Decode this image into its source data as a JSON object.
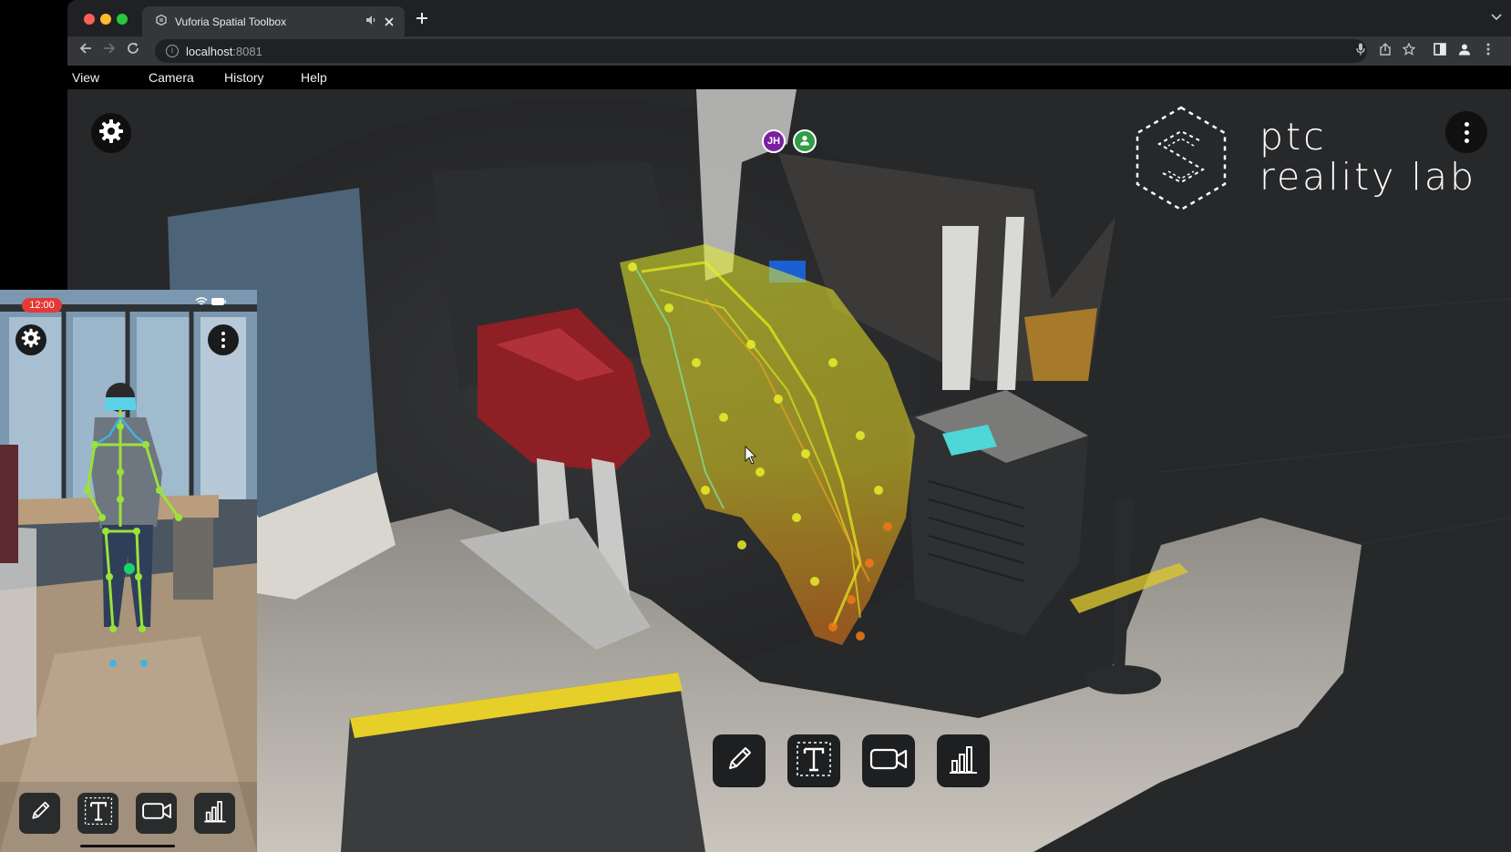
{
  "browser": {
    "tab": {
      "favicon": "spatial-toolbox-icon",
      "title": "Vuforia Spatial Toolbox",
      "mute_icon": "speaker-icon",
      "close_icon": "close-icon"
    },
    "new_tab_icon": "plus-icon",
    "tab_menu_icon": "chevron-down-icon",
    "nav": {
      "back_icon": "arrow-left-icon",
      "forward_icon": "arrow-right-icon",
      "reload_icon": "reload-icon"
    },
    "address": {
      "host": "localhost",
      "port": ":8081"
    },
    "toolbar_icons": [
      "microphone-icon",
      "share-icon",
      "star-icon",
      "sidebar-icon",
      "profile-icon",
      "more-vert-icon"
    ]
  },
  "menubar": {
    "items": [
      "View",
      "Camera",
      "History",
      "Help"
    ]
  },
  "viewport": {
    "settings_icon": "gear-icon",
    "more_icon": "kebab-icon",
    "collaborators": [
      {
        "initials": "JH",
        "color": "#7b1fa2"
      },
      {
        "initials": "",
        "icon": "person-icon",
        "color": "#2e9e48"
      }
    ],
    "logo": {
      "mark_icon": "hexagon-s-logo-icon",
      "line1": "ptc",
      "line2": "reality lab"
    },
    "tools": [
      {
        "name": "pencil-tool",
        "icon": "pencil-icon"
      },
      {
        "name": "text-tool",
        "icon": "text-icon"
      },
      {
        "name": "video-tool",
        "icon": "video-camera-icon"
      },
      {
        "name": "chart-tool",
        "icon": "bar-chart-icon"
      }
    ]
  },
  "phone": {
    "time": "12:00",
    "status_icons": [
      "wifi-icon",
      "battery-icon"
    ],
    "settings_icon": "gear-icon",
    "more_icon": "kebab-icon",
    "tools": [
      {
        "name": "pencil-tool",
        "icon": "pencil-icon"
      },
      {
        "name": "text-tool",
        "icon": "text-icon"
      },
      {
        "name": "video-tool",
        "icon": "video-camera-icon"
      },
      {
        "name": "chart-tool",
        "icon": "bar-chart-icon"
      }
    ]
  },
  "colors": {
    "browser_chrome": "#202124",
    "toolbar": "#35363a",
    "viewport_bg": "#262728",
    "motion_trail_yellow": "#e8f020",
    "motion_trail_orange": "#f07818",
    "skeleton_green": "#9be23a",
    "skeleton_blue": "#3fb3e6",
    "time_pill": "#e53935"
  }
}
